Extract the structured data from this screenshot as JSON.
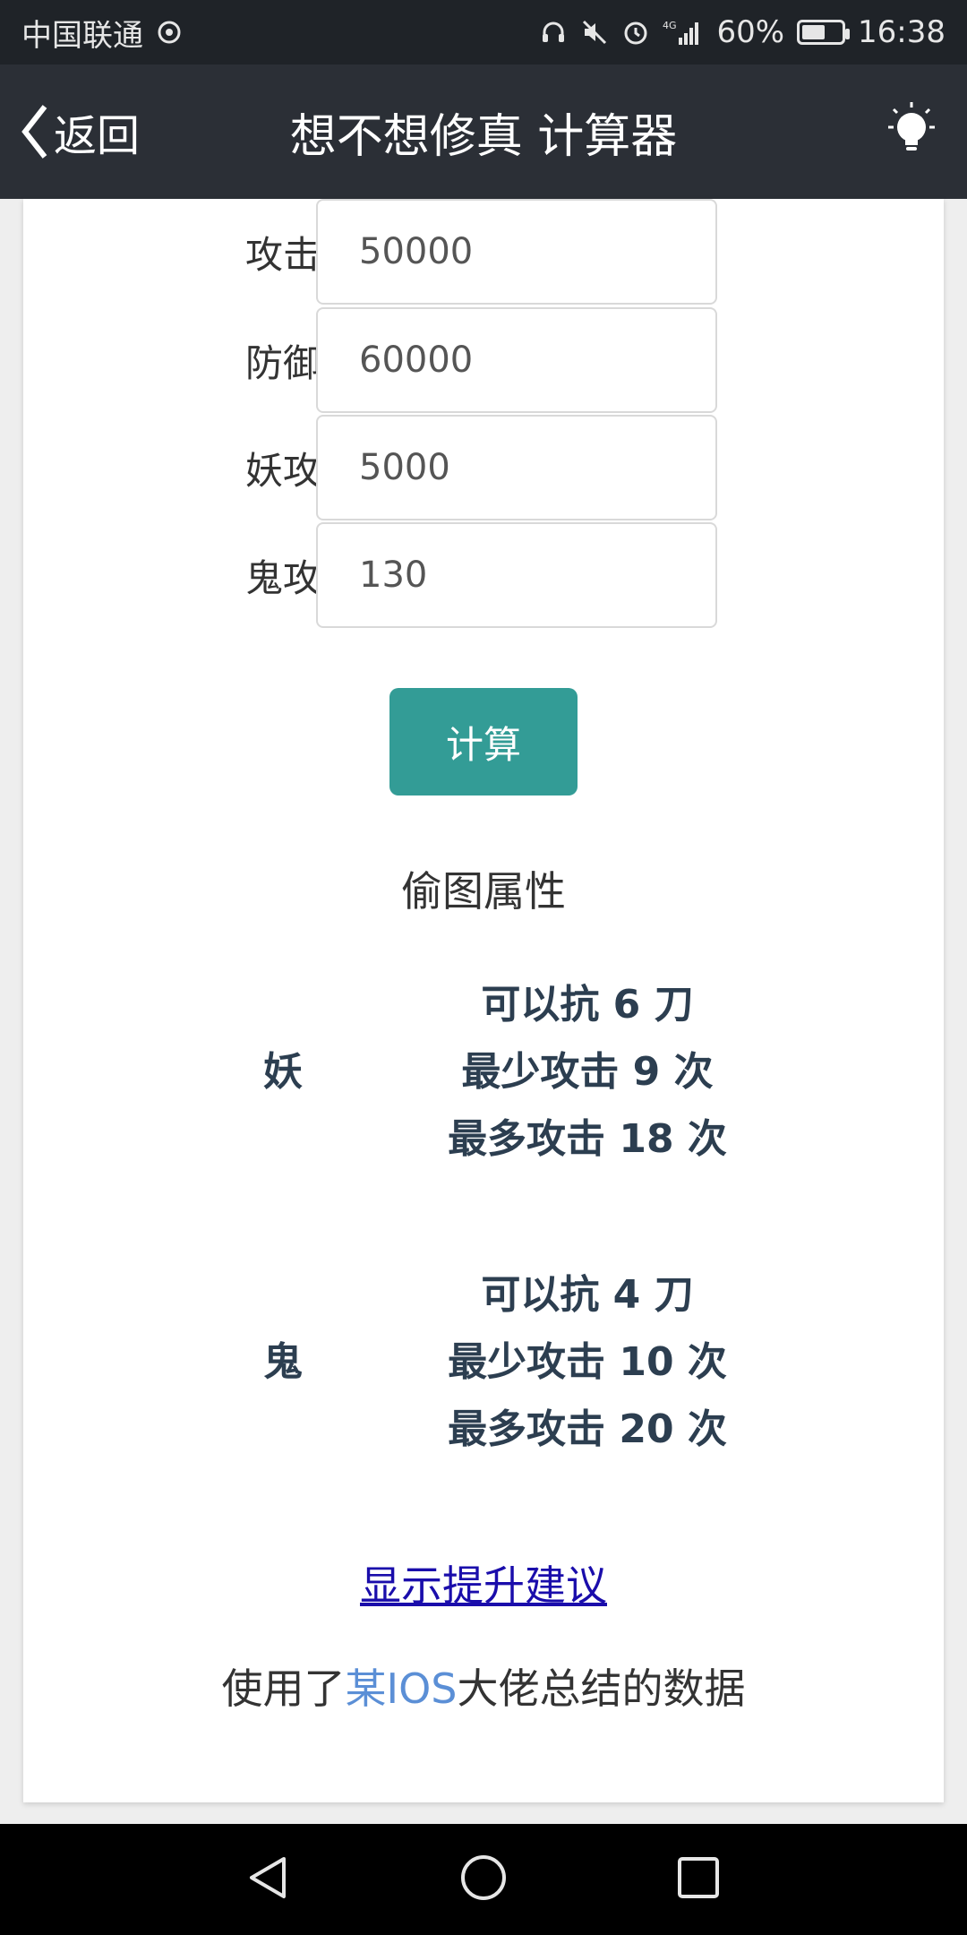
{
  "status_bar": {
    "carrier": "中国联通",
    "battery_percent": "60%",
    "battery_level": 0.6,
    "time": "16:38",
    "network": "4G",
    "icons": [
      "headset-icon",
      "mute-icon",
      "alarm-icon",
      "signal-icon",
      "battery-icon"
    ]
  },
  "header": {
    "back_label": "返回",
    "title": "想不想修真 计算器",
    "right_icon": "lightbulb-icon"
  },
  "form": {
    "fields": [
      {
        "label": "攻击",
        "value": "50000"
      },
      {
        "label": "防御",
        "value": "60000"
      },
      {
        "label": "妖攻",
        "value": "5000"
      },
      {
        "label": "鬼攻",
        "value": "130"
      }
    ],
    "calc_button": "计算"
  },
  "results": {
    "heading": "偷图属性",
    "blocks": [
      {
        "type": "妖",
        "lines": [
          "可以抗 6 刀",
          "最少攻击 9 次",
          "最多攻击 18 次"
        ]
      },
      {
        "type": "鬼",
        "lines": [
          "可以抗 4 刀",
          "最少攻击 10 次",
          "最多攻击 20 次"
        ]
      }
    ]
  },
  "footer": {
    "advice_link": "显示提升建议",
    "credit_prefix": "使用了",
    "credit_link": "某IOS",
    "credit_suffix": "大佬总结的数据"
  },
  "colors": {
    "status_bg": "#1f2328",
    "header_bg": "#2b2f36",
    "button_teal": "#339c96",
    "result_text": "#2c3e50",
    "link_blue": "#1a0dab",
    "credit_link": "#5b8fd6"
  }
}
